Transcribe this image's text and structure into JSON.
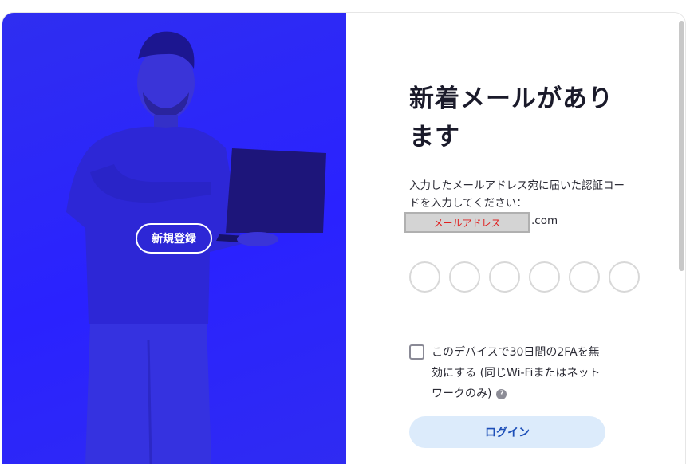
{
  "promo": {
    "signup_label": "新規登録",
    "background_color": "#2a22ff"
  },
  "form": {
    "title": "新着メールがあります",
    "description": "入力したメールアドレス宛に届いた認証コードを入力してください：",
    "email_mask": "メールアドレス",
    "email_suffix": ".com",
    "code_digits": 6,
    "remember_label": "このデバイスで30日間の2FAを無効にする (同じWi-Fiまたはネットワークのみ)",
    "help_icon": "?",
    "login_label": "ログイン"
  },
  "colors": {
    "accent": "#1d4fb8",
    "login_bg": "#dcebfb",
    "mask_text": "#e02020"
  }
}
